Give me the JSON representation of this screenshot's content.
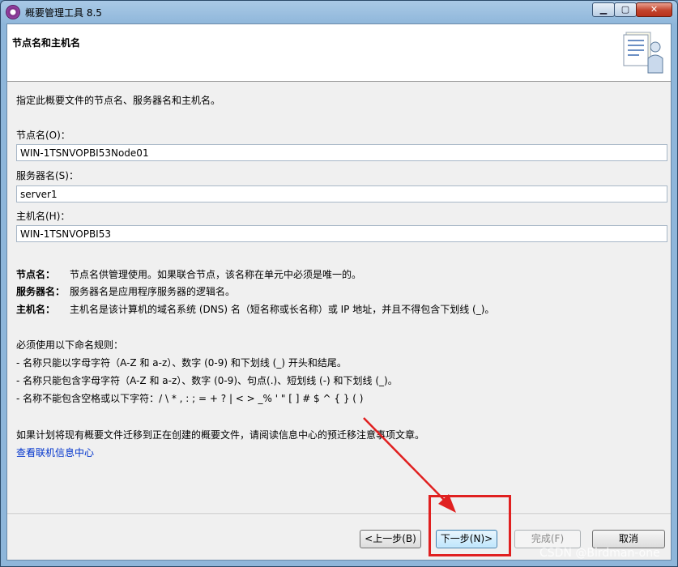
{
  "window": {
    "title": "概要管理工具 8.5",
    "minimize": "▁",
    "maximize": "▢",
    "close": "✕"
  },
  "page": {
    "header_title": "节点名和主机名",
    "intro": "指定此概要文件的节点名、服务器名和主机名。"
  },
  "fields": {
    "node_label": "节点名(O)：",
    "node_value": "WIN-1TSNVOPBI53Node01",
    "server_label": "服务器名(S)：",
    "server_value": "server1",
    "host_label": "主机名(H)：",
    "host_value": "WIN-1TSNVOPBI53"
  },
  "descriptions": {
    "node_term": "节点名：",
    "node_desc": "节点名供管理使用。如果联合节点，该名称在单元中必须是唯一的。",
    "server_term": "服务器名：",
    "server_desc": "服务器名是应用程序服务器的逻辑名。",
    "host_term": "主机名：",
    "host_desc": "主机名是该计算机的域名系统 (DNS) 名（短名称或长名称）或 IP 地址，并且不得包含下划线 (_)。"
  },
  "rules": {
    "heading": "必须使用以下命名规则：",
    "items": [
      "-  名称只能以字母字符（A-Z 和 a-z）、数字 (0-9) 和下划线 (_) 开头和结尾。",
      "-  名称只能包含字母字符（A-Z 和 a-z）、数字 (0-9)、句点(.)、短划线 (-) 和下划线 (_)。",
      "-  名称不能包含空格或以下字符：/ \\ * , : ; = + ? | < > _% ' \" [ ] # $ ^ { } ( )"
    ]
  },
  "migration_note": "如果计划将现有概要文件迁移到正在创建的概要文件，请阅读信息中心的预迁移注意事项文章。",
  "link": "查看联机信息中心",
  "buttons": {
    "back": "<上一步(B)",
    "next": "下一步(N)>",
    "finish": "完成(F)",
    "cancel": "取消"
  },
  "watermark": "CSDN @Birdman-one",
  "colors": {
    "highlight": "#e02020",
    "link": "#0033cc"
  }
}
